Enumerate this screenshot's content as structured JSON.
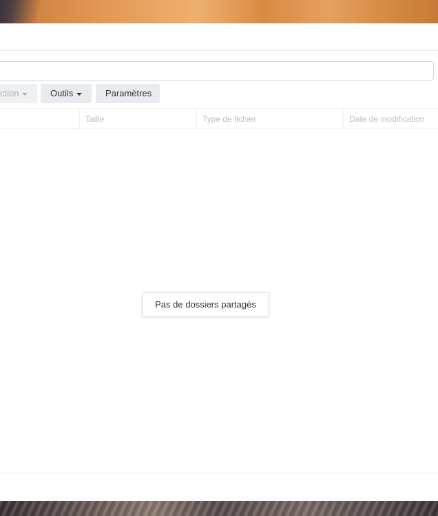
{
  "toolbar": {
    "action_label": "ction",
    "tools_label": "Outils",
    "settings_label": "Paramètres"
  },
  "path_input": {
    "value": ""
  },
  "table": {
    "columns": [
      "",
      "Taille",
      "Type de fichier",
      "Date de modification"
    ]
  },
  "empty_state": {
    "message": "Pas de dossiers partagés"
  }
}
